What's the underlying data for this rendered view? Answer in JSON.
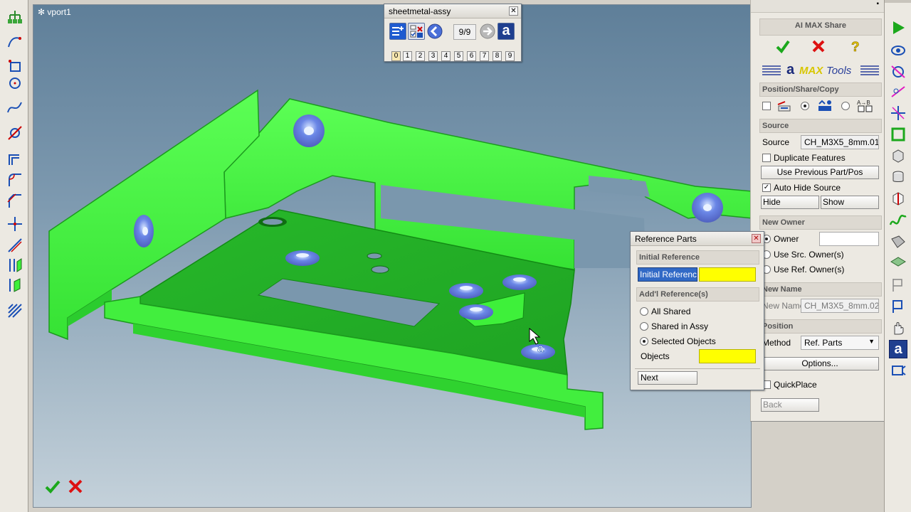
{
  "viewport": {
    "title": "vport1",
    "ok_icon": "check-icon",
    "cancel_icon": "x-icon"
  },
  "sheetmetal_toolbar": {
    "title": "sheetmetal-assy",
    "counter": "9/9",
    "numbers": [
      "0",
      "1",
      "2",
      "3",
      "4",
      "5",
      "6",
      "7",
      "8",
      "9"
    ]
  },
  "ai_max_share": {
    "title": "AI MAX Share",
    "logo_letter": "a",
    "logo_brand": "MAX",
    "logo_tools": "Tools",
    "position_section": "Position/Share/Copy",
    "source_section": "Source",
    "source_label": "Source",
    "source_value": "CH_M3X5_8mm.01",
    "duplicate_features": "Duplicate Features",
    "use_previous": "Use Previous Part/Pos",
    "auto_hide_source": "Auto Hide Source",
    "hide": "Hide",
    "show": "Show",
    "new_owner_section": "New Owner",
    "owner_label": "Owner",
    "owner_value": "",
    "use_src_owner": "Use Src. Owner(s)",
    "use_ref_owner": "Use Ref. Owner(s)",
    "new_name_section": "New Name",
    "new_name_label": "New Name",
    "new_name_value": "CH_M3X5_8mm.02",
    "position_section2": "Position",
    "method_label": "Method",
    "method_value": "Ref. Parts",
    "options": "Options...",
    "quickplace": "QuickPlace",
    "back": "Back"
  },
  "reference_parts": {
    "title": "Reference Parts",
    "initial_section": "Initial Reference",
    "initial_value": "Initial Referenc",
    "addl_section": "Add'l Reference(s)",
    "all_shared": "All Shared",
    "shared_in_assy": "Shared in Assy",
    "selected_objects": "Selected Objects",
    "objects_label": "Objects",
    "next": "Next"
  },
  "colors": {
    "part_green": "#3ef03a",
    "highlight_yellow": "#ffff00",
    "selection_blue": "#3169c6"
  }
}
